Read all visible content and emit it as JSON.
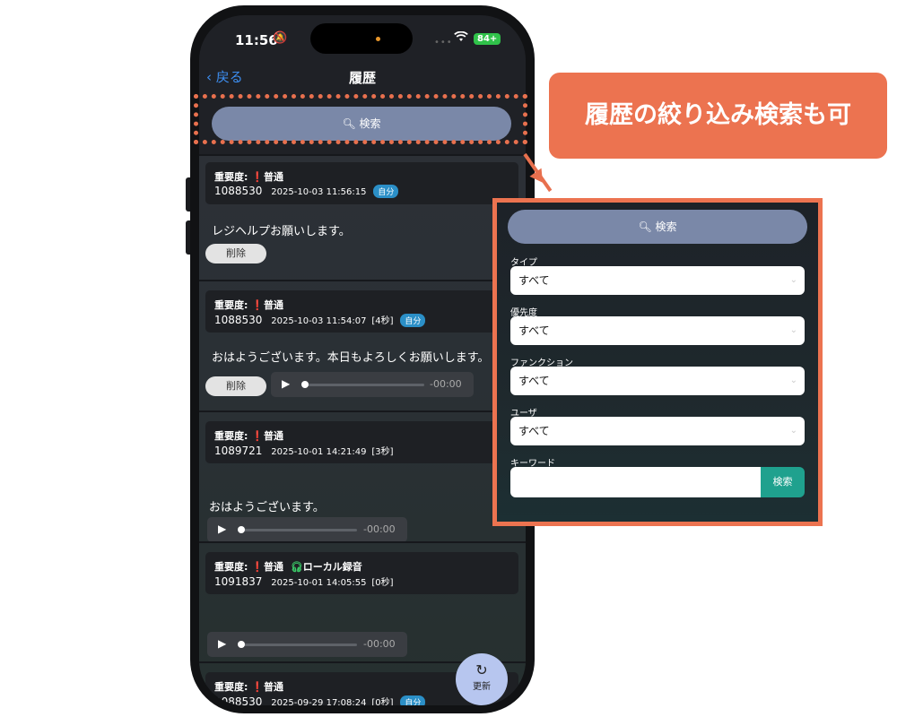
{
  "status": {
    "time": "11:56",
    "mute_icon": "bell-slash-icon",
    "signal": "•••",
    "wifi_icon": "wifi-icon",
    "battery": "84+"
  },
  "nav": {
    "back": "戻る",
    "title": "履歴"
  },
  "search": {
    "label": "検索"
  },
  "cards": [
    {
      "importance_label": "重要度:",
      "importance": "普通",
      "user": "1088530",
      "datetime": "2025-10-03 11:56:15",
      "duration": "",
      "badge": "自分",
      "message": "レジヘルプお願いします。",
      "delete": "削除"
    },
    {
      "importance_label": "重要度:",
      "importance": "普通",
      "user": "1088530",
      "datetime": "2025-10-03 11:54:07",
      "duration": "[4秒]",
      "badge": "自分",
      "message": "おはようございます。本日もよろしくお願いします。",
      "delete": "削除",
      "player_time": "-00:00"
    },
    {
      "importance_label": "重要度:",
      "importance": "普通",
      "user": "1089721",
      "datetime": "2025-10-01 14:21:49",
      "duration": "[3秒]",
      "message": "おはようございます。",
      "player_time": "-00:00"
    },
    {
      "importance_label": "重要度:",
      "importance": "普通",
      "local": "ローカル録音",
      "user": "1091837",
      "datetime": "2025-10-01 14:05:55",
      "duration": "[0秒]",
      "player_time": "-00:00"
    },
    {
      "importance_label": "重要度:",
      "importance": "普通",
      "user": "1088530",
      "datetime": "2025-09-29 17:08:24",
      "duration": "[0秒]",
      "badge": "自分"
    }
  ],
  "refresh": {
    "label": "更新"
  },
  "callout": {
    "text": "履歴の絞り込み検索も可"
  },
  "filter_panel": {
    "search_label": "検索",
    "fields": [
      {
        "label": "タイプ",
        "value": "すべて"
      },
      {
        "label": "優先度",
        "value": "すべて"
      },
      {
        "label": "ファンクション",
        "value": "すべて"
      },
      {
        "label": "ユーザ",
        "value": "すべて"
      }
    ],
    "keyword_label": "キーワード",
    "keyword_value": "",
    "keyword_button": "検索"
  },
  "colors": {
    "accent_orange": "#ec7350",
    "search_pill": "#7a88a8",
    "badge_blue": "#2b8fc7",
    "keyword_button": "#1fa18e"
  }
}
